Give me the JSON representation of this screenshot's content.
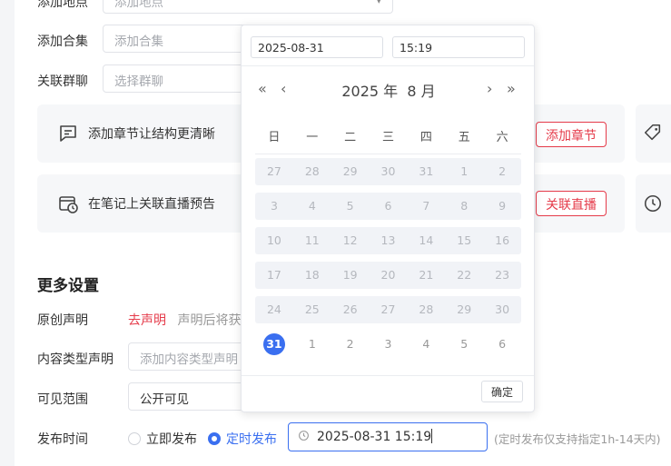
{
  "form": {
    "location": {
      "label": "添加地点",
      "placeholder": "添加地点"
    },
    "collection": {
      "label": "添加合集",
      "placeholder": "添加合集"
    },
    "group": {
      "label": "关联群聊",
      "placeholder": "选择群聊"
    },
    "chapter_card": {
      "text": "添加章节让结构更清晰",
      "button": "添加章节"
    },
    "live_card": {
      "text": "在笔记上关联直播预告",
      "button": "关联直播"
    }
  },
  "more": {
    "title": "更多设置",
    "original": {
      "label": "原创声明",
      "link": "去声明",
      "hint": "声明后将获"
    },
    "content_type": {
      "label": "内容类型声明",
      "placeholder": "添加内容类型声明"
    },
    "visibility": {
      "label": "可见范围",
      "value": "公开可见"
    },
    "publish": {
      "label": "发布时间",
      "now": "立即发布",
      "scheduled": "定时发布",
      "value": "2025-08-31 15:19",
      "hint": "(定时发布仅支持指定1h-14天内)"
    }
  },
  "picker": {
    "date": "2025-08-31",
    "time": "15:19",
    "title": "2025 年  8 月",
    "nav": {
      "prev_year": "«",
      "prev_month": "‹",
      "next_month": "›",
      "next_year": "»"
    },
    "weekdays": [
      "日",
      "一",
      "二",
      "三",
      "四",
      "五",
      "六"
    ],
    "weeks": [
      [
        "27",
        "28",
        "29",
        "30",
        "31",
        "1",
        "2"
      ],
      [
        "3",
        "4",
        "5",
        "6",
        "7",
        "8",
        "9"
      ],
      [
        "10",
        "11",
        "12",
        "13",
        "14",
        "15",
        "16"
      ],
      [
        "17",
        "18",
        "19",
        "20",
        "21",
        "22",
        "23"
      ],
      [
        "24",
        "25",
        "26",
        "27",
        "28",
        "29",
        "30"
      ],
      [
        "31",
        "1",
        "2",
        "3",
        "4",
        "5",
        "6"
      ]
    ],
    "selected": "31",
    "confirm": "确定"
  },
  "colors": {
    "accent": "#3a6ff0",
    "danger": "#e53b4a"
  }
}
